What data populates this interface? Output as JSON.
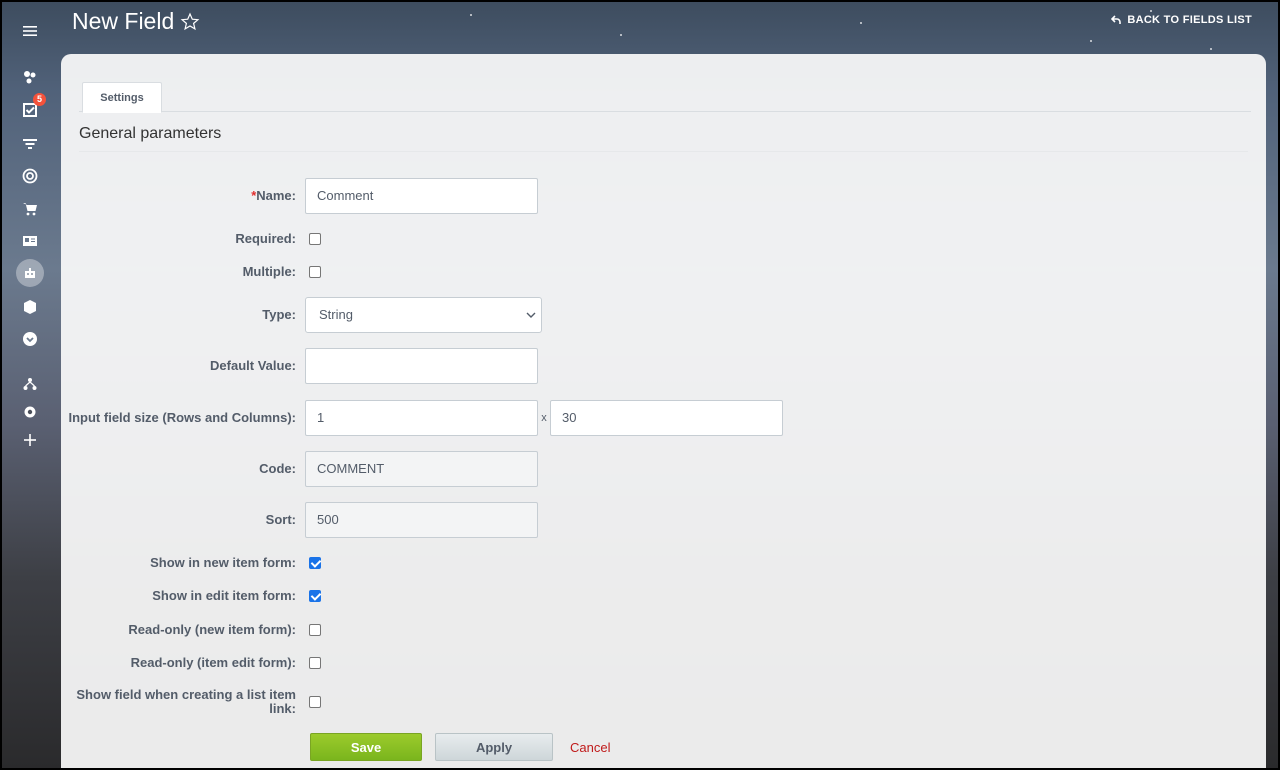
{
  "header": {
    "title": "New Field",
    "back_link": "BACK TO FIELDS LIST"
  },
  "rail": {
    "badge_count": "5"
  },
  "tabs": [
    {
      "label": "Settings"
    }
  ],
  "section": {
    "title": "General parameters"
  },
  "form": {
    "name": {
      "required_mark": "*",
      "label": "Name:",
      "value": "Comment"
    },
    "required": {
      "label": "Required:",
      "checked": false
    },
    "multiple": {
      "label": "Multiple:",
      "checked": false
    },
    "type": {
      "label": "Type:",
      "value": "String"
    },
    "default_value": {
      "label": "Default Value:",
      "value": ""
    },
    "input_size": {
      "label": "Input field size (Rows and Columns):",
      "rows": "1",
      "separator": "x",
      "columns": "30"
    },
    "code": {
      "label": "Code:",
      "value": "COMMENT"
    },
    "sort": {
      "label": "Sort:",
      "value": "500"
    },
    "show_new": {
      "label": "Show in new item form:",
      "checked": true
    },
    "show_edit": {
      "label": "Show in edit item form:",
      "checked": true
    },
    "readonly_new": {
      "label": "Read-only (new item form):",
      "checked": false
    },
    "readonly_edit": {
      "label": "Read-only (item edit form):",
      "checked": false
    },
    "show_link": {
      "label": "Show field when creating a list item link:",
      "checked": false
    }
  },
  "buttons": {
    "save": "Save",
    "apply": "Apply",
    "cancel": "Cancel"
  },
  "colors": {
    "save_green": "#87bf24",
    "cancel_red": "#c01b1b",
    "badge_red": "#f5523b",
    "checkbox_blue": "#1a73e8"
  }
}
